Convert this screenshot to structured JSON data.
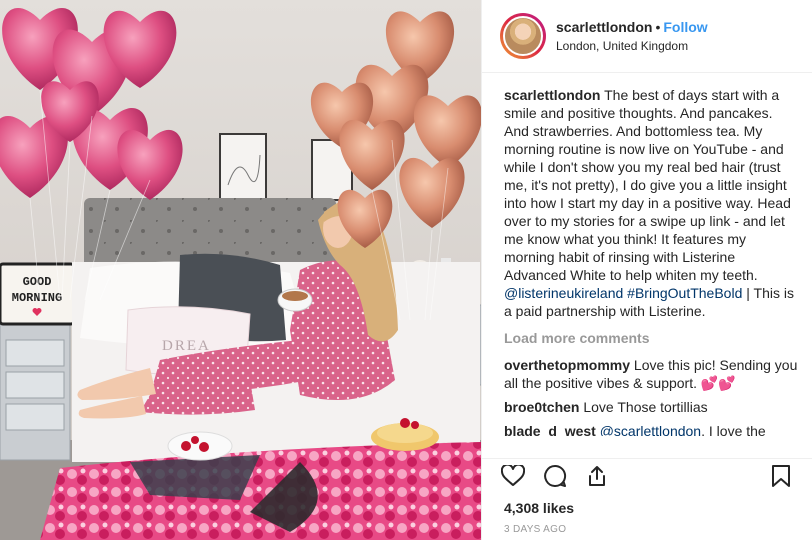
{
  "header": {
    "username": "scarlettlondon",
    "separator": "•",
    "follow_label": "Follow",
    "location": "London, United Kingdom"
  },
  "photo": {
    "lightbox_lines": [
      "GOOD",
      "MORNING"
    ],
    "pillow_text": "DREA"
  },
  "caption": {
    "username": "scarlettlondon",
    "text": "The best of days start with a smile and positive thoughts. And pancakes. And strawberries. And bottomless tea. My morning routine is now live on YouTube - and while I don't show you my real bed hair (trust me, it's not pretty), I do give you a little insight into how I start my day in a positive way. Head over to my stories for a swipe up link - and let me know what you think! It features my morning habit of rinsing with Listerine Advanced White to help whiten my teeth.",
    "mention": "@listerineukireland",
    "hashtag": "#BringOutTheBold",
    "tail": " | This is a paid partnership with Listerine."
  },
  "load_more": "Load more comments",
  "comments": [
    {
      "username": "overthetopmommy",
      "text": "Love this pic! Sending you all the positive vibes & support. 💕💕"
    },
    {
      "username": "broe0tchen",
      "text": "Love Those tortillias"
    },
    {
      "username": "blade_d_west",
      "mention": "@scarlettlondon",
      "text": ", I love the"
    }
  ],
  "likes": "4,308 likes",
  "timestamp": "3 DAYS AGO",
  "icons": [
    "heart-icon",
    "comment-icon",
    "share-icon",
    "bookmark-icon"
  ],
  "colors": {
    "accent": "#3897f0",
    "link": "#003569",
    "muted": "#999999"
  }
}
